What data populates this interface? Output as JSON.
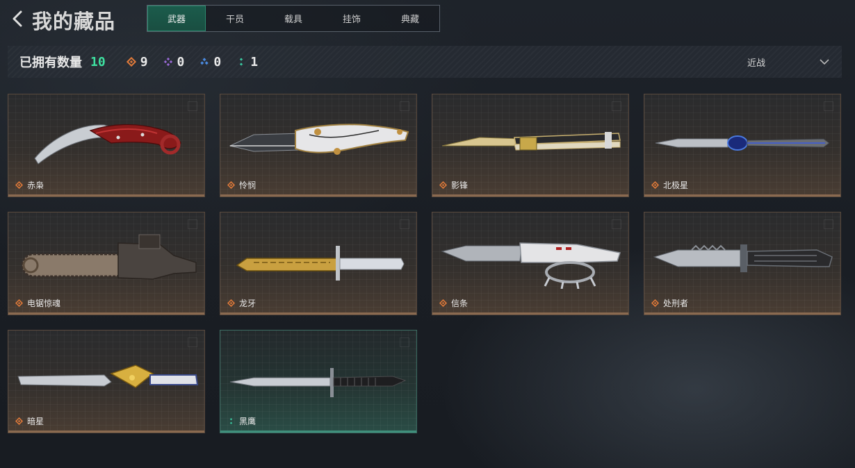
{
  "header": {
    "title": "我的藏品",
    "tabs": [
      "武器",
      "干员",
      "载具",
      "挂饰",
      "典藏"
    ]
  },
  "stats": {
    "owned_label": "已拥有数量",
    "owned_count": "10",
    "rarity_counts": [
      {
        "icon": "orange-diamond-icon",
        "color": "#e07a3a",
        "count": "9"
      },
      {
        "icon": "purple-diamond-icon",
        "color": "#9a6ad8",
        "count": "0"
      },
      {
        "icon": "blue-diamond-icon",
        "color": "#4a8ae0",
        "count": "0"
      },
      {
        "icon": "green-diamond-icon",
        "color": "#3ac8a0",
        "count": "1"
      }
    ],
    "filter_label": "近战"
  },
  "items": [
    {
      "name": "赤枭",
      "rarity": "orange"
    },
    {
      "name": "怜悯",
      "rarity": "orange"
    },
    {
      "name": "影锋",
      "rarity": "orange"
    },
    {
      "name": "北极星",
      "rarity": "orange"
    },
    {
      "name": "电锯惊魂",
      "rarity": "orange"
    },
    {
      "name": "龙牙",
      "rarity": "orange"
    },
    {
      "name": "信条",
      "rarity": "orange"
    },
    {
      "name": "处刑者",
      "rarity": "orange"
    },
    {
      "name": "暗星",
      "rarity": "orange"
    },
    {
      "name": "黑鹰",
      "rarity": "green"
    }
  ],
  "colors": {
    "accent_green": "#3ee0a0",
    "orange_rarity": "#e07a3a",
    "green_rarity": "#3ac8a0"
  }
}
